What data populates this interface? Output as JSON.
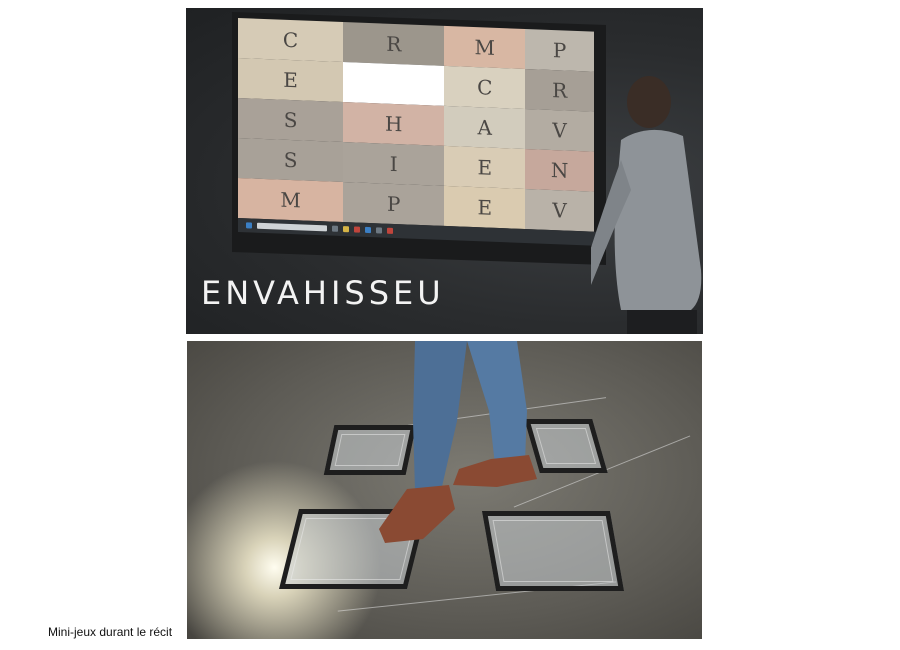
{
  "top_photo": {
    "letter_grid": [
      [
        "C",
        "R",
        "M",
        "P"
      ],
      [
        "E",
        "",
        "C",
        "R"
      ],
      [
        "S",
        "H",
        "A",
        "V"
      ],
      [
        "S",
        "I",
        "E",
        "N"
      ],
      [
        "M",
        "P",
        "E",
        "V"
      ]
    ],
    "cell_colors": [
      [
        "#d6cbb6",
        "#9c968c",
        "#d8b7a3",
        "#bdb7ad"
      ],
      [
        "#d3c8b2",
        "#ffffff",
        "#d9d1bf",
        "#a69f96"
      ],
      [
        "#a9a198",
        "#d2b3a5",
        "#d2ccbd",
        "#b3aca2"
      ],
      [
        "#a8a198",
        "#aaa39a",
        "#d9ccb5",
        "#c6a89c"
      ],
      [
        "#d7b4a1",
        "#aaa39a",
        "#dacbb0",
        "#b9b2a8"
      ]
    ],
    "overlay_title": "ENVAHISSEU"
  },
  "bottom_photo": {
    "subject": "floor-pads"
  },
  "caption": "Mini-jeux durant le récit"
}
